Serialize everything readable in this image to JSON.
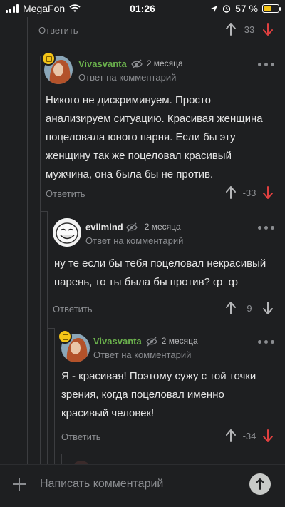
{
  "status_bar": {
    "carrier": "MegaFon",
    "time": "01:26",
    "battery_percent": "57 %",
    "battery_level": 0.57,
    "battery_color": "#f5c518"
  },
  "colors": {
    "background": "#1e1f21",
    "author": "#6ab04c",
    "muted": "#8b8d91",
    "vote_up": "#b5b6b8",
    "vote_down": "#e04040"
  },
  "reply_label": "Ответить",
  "top_action": {
    "rating": "33"
  },
  "comments": [
    {
      "author": "Vivasvanta",
      "time": "2 месяца",
      "reply_to": "Ответ на комментарий",
      "text_lines": [
        "Никого не дискриминуем. Просто",
        "анализируем ситуацию. Красивая женщина",
        "поцеловала юного парня. Если бы эту",
        "женщину так же поцеловал красивый",
        "мужчина, она была бы не против."
      ],
      "rating": "-33"
    },
    {
      "author": "evilmind",
      "time": "2 месяца",
      "reply_to": "Ответ на комментарий",
      "text_lines": [
        "ну те если бы тебя поцеловал некрасивый",
        "парень, то ты была бы против? ȹ_ȹ"
      ],
      "rating": "9"
    },
    {
      "author": "Vivasvanta",
      "time": "2 месяца",
      "reply_to": "Ответ на комментарий",
      "text_lines": [
        "Я - красивая! Поэтому сужу с той точки",
        "зрения, когда поцеловал именно",
        "красивый человек!"
      ],
      "rating": "-34"
    }
  ],
  "bottom_bar": {
    "placeholder": "Написать комментарий"
  }
}
